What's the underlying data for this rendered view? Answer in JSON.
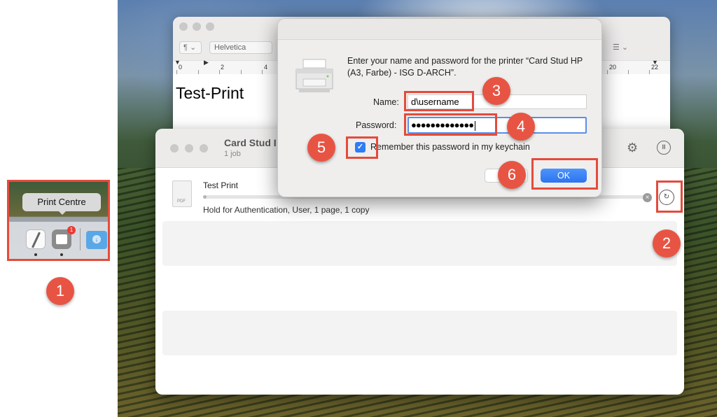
{
  "dock": {
    "tooltip": "Print Centre",
    "print_badge": "1",
    "icons": [
      "textedit-icon",
      "print-centre-icon",
      "downloads-folder-icon"
    ]
  },
  "textedit": {
    "paragraph_menu": "¶ ⌄",
    "font_name": "Helvetica",
    "list_menu": "☰ ⌄",
    "ruler_numbers": [
      "0",
      "2",
      "4",
      "20",
      "22"
    ],
    "document_text": "Test-Print"
  },
  "queue": {
    "title": "Card Stud I",
    "subtitle": "1 job",
    "job": {
      "name": "Test Print",
      "thumbnail_label": "PDF",
      "status": "Hold for Authentication, User, 1 page, 1 copy"
    }
  },
  "dialog": {
    "message": "Enter your name and password for the printer “Card Stud HP (A3, Farbe) - ISG D-ARCH”.",
    "name_label": "Name:",
    "name_value": "d\\username",
    "password_label": "Password:",
    "password_value": "●●●●●●●●●●●●●",
    "remember_label": "Remember this password in my keychain",
    "remember_checked": true,
    "cancel_label": "C",
    "ok_label": "OK"
  },
  "annotations": [
    "1",
    "2",
    "3",
    "4",
    "5",
    "6"
  ],
  "colors": {
    "annotation_red": "#e44b3c",
    "accent_blue": "#2f7cf6"
  }
}
